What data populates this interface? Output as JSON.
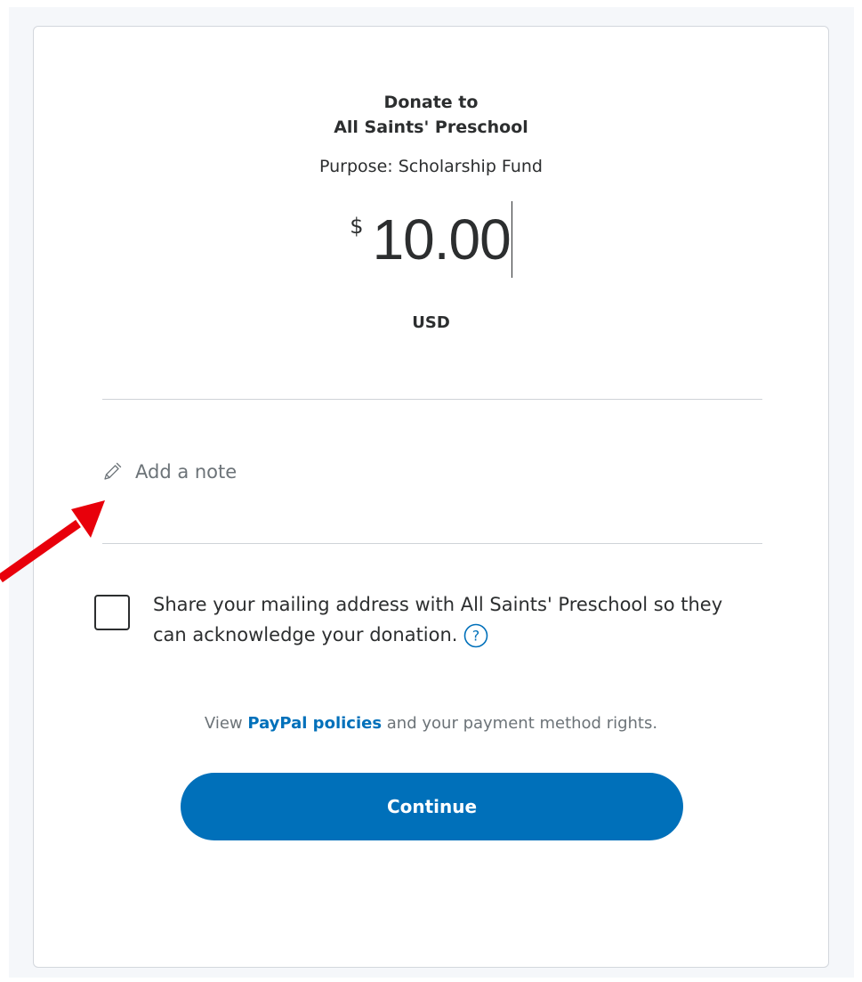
{
  "donation": {
    "heading": "Donate to",
    "organization": "All Saints' Preschool",
    "purpose": "Purpose: Scholarship Fund",
    "currency_symbol": "$",
    "amount": "10.00",
    "currency_code": "USD"
  },
  "note": {
    "label": "Add a note",
    "icon": "pencil-icon"
  },
  "share_address": {
    "checked": false,
    "text": "Share your mailing address with All Saints' Preschool so they can acknowledge your donation.",
    "help_icon": "question-circle-icon"
  },
  "policies": {
    "prefix": "View",
    "link": "PayPal policies",
    "suffix": "and your payment method rights."
  },
  "actions": {
    "continue_label": "Continue"
  },
  "colors": {
    "brand_blue": "#0070ba",
    "text_dark": "#2c2e2f",
    "text_muted": "#6c7378",
    "annotation_red": "#e8000b"
  }
}
